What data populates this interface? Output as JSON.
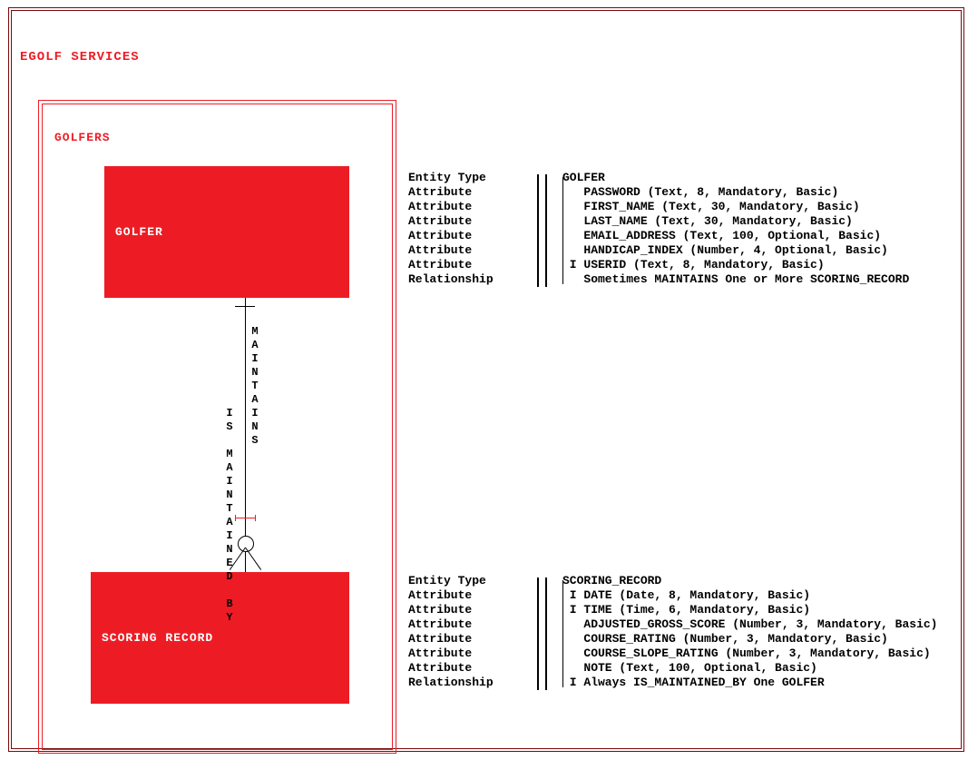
{
  "title": "EGOLF SERVICES",
  "subject": {
    "title": "GOLFERS",
    "entity1": "GOLFER",
    "entity2": "SCORING RECORD",
    "rel_forward": "MAINTAINS",
    "rel_back": "IS MAINTAINED BY"
  },
  "def1": {
    "rows": [
      {
        "lab": "Entity Type",
        "pre": "",
        "val": "GOLFER"
      },
      {
        "lab": "Attribute",
        "pre": "   ",
        "val": "PASSWORD (Text, 8, Mandatory, Basic)"
      },
      {
        "lab": "Attribute",
        "pre": "   ",
        "val": "FIRST_NAME (Text, 30, Mandatory, Basic)"
      },
      {
        "lab": "Attribute",
        "pre": "   ",
        "val": "LAST_NAME (Text, 30, Mandatory, Basic)"
      },
      {
        "lab": "Attribute",
        "pre": "   ",
        "val": "EMAIL_ADDRESS (Text, 100, Optional, Basic)"
      },
      {
        "lab": "Attribute",
        "pre": "   ",
        "val": "HANDICAP_INDEX (Number, 4, Optional, Basic)"
      },
      {
        "lab": "Attribute",
        "pre": " I ",
        "val": "USERID (Text, 8, Mandatory, Basic)"
      },
      {
        "lab": "Relationship",
        "pre": "   ",
        "val": "Sometimes MAINTAINS One or More SCORING_RECORD"
      }
    ]
  },
  "def2": {
    "rows": [
      {
        "lab": "Entity Type",
        "pre": "",
        "val": "SCORING_RECORD"
      },
      {
        "lab": "Attribute",
        "pre": " I ",
        "val": "DATE (Date, 8, Mandatory, Basic)"
      },
      {
        "lab": "Attribute",
        "pre": " I ",
        "val": "TIME (Time, 6, Mandatory, Basic)"
      },
      {
        "lab": "Attribute",
        "pre": "   ",
        "val": "ADJUSTED_GROSS_SCORE (Number, 3, Mandatory, Basic)"
      },
      {
        "lab": "Attribute",
        "pre": "   ",
        "val": "COURSE_RATING (Number, 3, Mandatory, Basic)"
      },
      {
        "lab": "Attribute",
        "pre": "   ",
        "val": "COURSE_SLOPE_RATING (Number, 3, Mandatory, Basic)"
      },
      {
        "lab": "Attribute",
        "pre": "   ",
        "val": "NOTE (Text, 100, Optional, Basic)"
      },
      {
        "lab": "Relationship",
        "pre": " I ",
        "val": "Always IS_MAINTAINED_BY One GOLFER"
      }
    ]
  }
}
